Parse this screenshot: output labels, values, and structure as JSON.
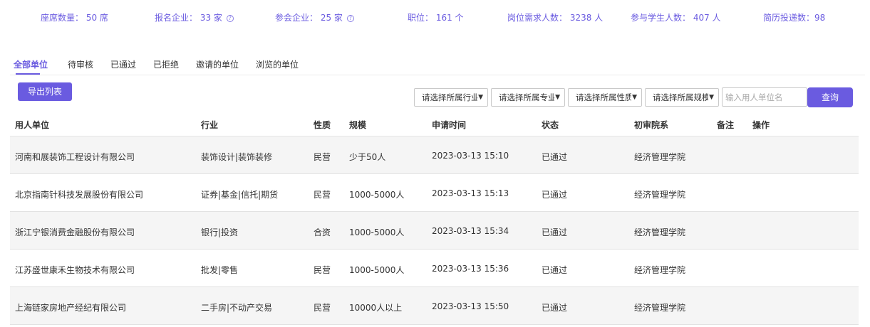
{
  "stats": [
    {
      "text": "座席数量： 50 席",
      "help": false
    },
    {
      "text": "报名企业： 33 家",
      "help": true
    },
    {
      "text": "参会企业： 25 家",
      "help": true
    },
    {
      "text": "职位： 161 个",
      "help": false
    },
    {
      "text": "岗位需求人数： 3238 人",
      "help": false
    },
    {
      "text": "参与学生人数： 407 人",
      "help": false
    },
    {
      "text": "简历投递数：98",
      "help": false
    }
  ],
  "help_glyph": "?",
  "tabs": [
    "全部单位",
    "待审核",
    "已通过",
    "已拒绝",
    "邀请的单位",
    "浏览的单位"
  ],
  "toolbar": {
    "export_label": "导出列表",
    "filters": [
      "请选择所属行业",
      "请选择所属专业",
      "请选择所属性质",
      "请选择所属规模"
    ],
    "caret": "▼",
    "search_placeholder": "输入用人单位名",
    "query_label": "查询"
  },
  "table": {
    "headers": [
      "用人单位",
      "行业",
      "性质",
      "规模",
      "申请时间",
      "状态",
      "初审院系",
      "备注",
      "操作"
    ],
    "rows": [
      [
        "河南和展装饰工程设计有限公司",
        "装饰设计|装饰装修",
        "民营",
        "少于50人",
        "2023-03-13 15:10",
        "已通过",
        "经济管理学院"
      ],
      [
        "北京指南针科技发展股份有限公司",
        "证券|基金|信托|期货",
        "民营",
        "1000-5000人",
        "2023-03-13 15:13",
        "已通过",
        "经济管理学院"
      ],
      [
        "浙江宁银消费金融股份有限公司",
        "银行|投资",
        "合资",
        "1000-5000人",
        "2023-03-13 15:34",
        "已通过",
        "经济管理学院"
      ],
      [
        "江苏盛世康禾生物技术有限公司",
        "批发|零售",
        "民营",
        "1000-5000人",
        "2023-03-13 15:36",
        "已通过",
        "经济管理学院"
      ],
      [
        "上海链家房地产经纪有限公司",
        "二手房|不动产交易",
        "民营",
        "10000人以上",
        "2023-03-13 15:50",
        "已通过",
        "经济管理学院"
      ]
    ]
  },
  "colors": {
    "accent": "#6a5be0"
  }
}
